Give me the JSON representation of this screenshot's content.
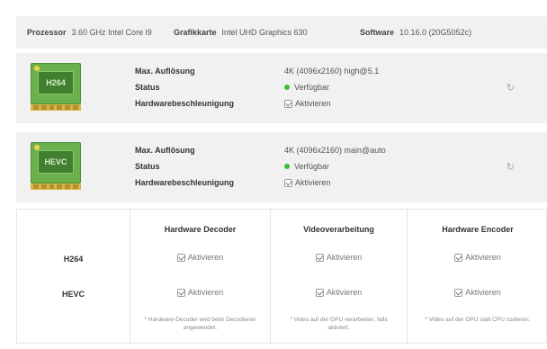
{
  "system": {
    "processor_label": "Prozessor",
    "processor_value": "3.60 GHz Intel Core i9",
    "gpu_label": "Grafikkarte",
    "gpu_value": "Intel UHD Graphics 630",
    "software_label": "Software",
    "software_value": "10.16.0 (20G5052c)"
  },
  "codecs": [
    {
      "chip_label": "H264",
      "max_res_label": "Max. Auflösung",
      "max_res_value": "4K (4096x2160) high@5.1",
      "status_label": "Status",
      "status_value": "Verfügbar",
      "hw_label": "Hardwarebeschleunigung",
      "hw_value": "Aktivieren"
    },
    {
      "chip_label": "HEVC",
      "max_res_label": "Max. Auflösung",
      "max_res_value": "4K (4096x2160) main@auto",
      "status_label": "Status",
      "status_value": "Verfügbar",
      "hw_label": "Hardwarebeschleunigung",
      "hw_value": "Aktivieren"
    }
  ],
  "matrix": {
    "headers": [
      "Hardware Decoder",
      "Videoverarbeitung",
      "Hardware Encoder"
    ],
    "rows": [
      "H264",
      "HEVC"
    ],
    "checkbox_label": "Aktivieren",
    "notes": [
      "* Hardware-Decoder wird beim Decodieren angewendet.",
      "* Video auf der GPU verarbeiten, falls aktiviert.",
      "* Video auf der GPU statt CPU codieren."
    ]
  },
  "colors": {
    "status_green": "#38c03c",
    "chip_green": "#6ab04c",
    "panel_bg": "#f1f1f1"
  },
  "icons": {
    "refresh": "refresh-icon",
    "chip": "gpu-chip-icon"
  }
}
